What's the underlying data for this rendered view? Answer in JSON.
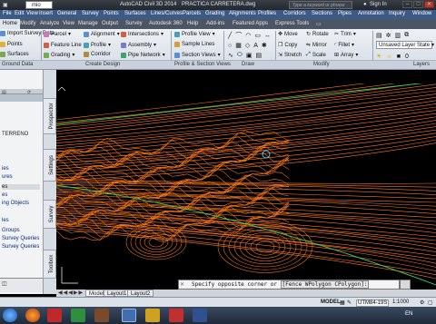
{
  "titlebar": {
    "app_title": "AutoCAD Civil 3D 2014",
    "file_name": "PRACTICA CARRETERA.dwg",
    "workspace": "mio",
    "search_placeholder": "Type a keyword or phrase",
    "sign_in": "Sign In"
  },
  "menubar": {
    "items": [
      "File",
      "Edit",
      "View",
      "Insert",
      "General",
      "Survey",
      "Points",
      "Surfaces",
      "Lines/Curves",
      "Parcels",
      "Grading",
      "Alignments",
      "Profiles",
      "Corridors",
      "Sections",
      "Pipes",
      "Annotation",
      "Inquiry",
      "Window"
    ]
  },
  "ribbon_tabs": {
    "items": [
      "Home",
      "Modify",
      "Analyze",
      "View",
      "Manage",
      "Output",
      "Survey",
      "Autodesk 360",
      "Help",
      "Add-ins",
      "Featured Apps",
      "Express Tools"
    ],
    "active": "Home"
  },
  "ribbon": {
    "col1": [
      "Import Survey Data",
      "Points",
      "Surfaces"
    ],
    "col2": [
      "Parcel",
      "Feature Line",
      "Grading"
    ],
    "col3": [
      "Alignment",
      "Profile",
      "Corridor"
    ],
    "col4": [
      "Intersections",
      "Assembly",
      "Pipe Network"
    ],
    "col5": [
      "Profile View",
      "Sample Lines",
      "Section Views"
    ],
    "modify1": [
      "Move",
      "Copy",
      "Stretch"
    ],
    "modify2": [
      "Rotate",
      "Mirror",
      "Scale"
    ],
    "modify3": [
      "Trim",
      "Fillet",
      "Array"
    ],
    "layer_state": "Unsaved Layer State",
    "groups": [
      "Ground Data",
      "Create Design",
      "Profile & Section Views",
      "Draw",
      "Modify",
      "Layers"
    ]
  },
  "palette": {
    "tree_items": [
      "TERRENO",
      "ies",
      "ures",
      "es",
      "es",
      "ing Objects",
      "les",
      "Groups",
      "Survey Queries",
      "Survey Queries"
    ],
    "selected_index": 4,
    "side_tabs": [
      "Prospector",
      "Settings",
      "Survey",
      "Toolbox"
    ]
  },
  "command_line": {
    "text": "Specify opposite corner or",
    "option": "[Fence WPolygon CPolygon]:"
  },
  "layout_tabs": {
    "items": [
      "Model",
      "Layout1",
      "Layout2"
    ],
    "active": "Model"
  },
  "statusbar": {
    "model": "MODEL",
    "coord_system": "UTM84-19S",
    "scale": "1:1000",
    "language": "EN"
  },
  "colors": {
    "contours": "#ff7a1a",
    "boundary": "#3ccf5a",
    "background": "#000000",
    "menubar": "#3c5a86"
  }
}
